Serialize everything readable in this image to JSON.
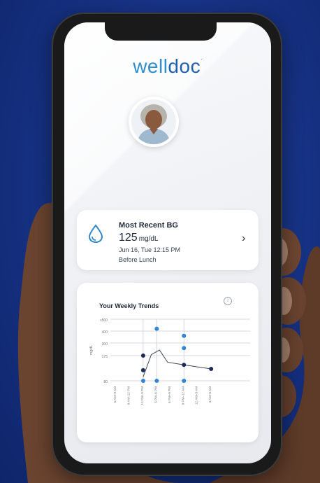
{
  "app": {
    "logo_light": "well",
    "logo_dark": "doc",
    "logo_mark": "."
  },
  "recent_bg": {
    "title": "Most Recent BG",
    "value": "125",
    "unit": "mg/dL",
    "date": "Jun 16, Tue 12:15 PM",
    "meal": "Before Lunch"
  },
  "trends": {
    "title": "Your Weekly Trends",
    "chart_data": {
      "type": "scatter",
      "title": "Your Weekly Trends",
      "ylabel": "mg/dL",
      "y_ticks": [
        ">500",
        "400",
        "300",
        "175",
        "80"
      ],
      "categories": [
        "6 AM–9 AM",
        "9 AM–12 PM",
        "12 PM–3 PM",
        "3 PM–6 PM",
        "6 PM–9 PM",
        "9 PM–12 AM",
        "12 AM–3 AM",
        "3 AM–6 AM"
      ],
      "points": [
        {
          "x": 2,
          "y": 175
        },
        {
          "x": 2,
          "y": 120
        },
        {
          "x": 2,
          "y": 80
        },
        {
          "x": 3,
          "y": 420
        },
        {
          "x": 3,
          "y": 80
        },
        {
          "x": 5,
          "y": 360
        },
        {
          "x": 5,
          "y": 250
        },
        {
          "x": 5,
          "y": 80
        },
        {
          "x": 5,
          "y": 140
        },
        {
          "x": 7,
          "y": 125
        }
      ],
      "trend_line": [
        {
          "x": 2,
          "y": 95
        },
        {
          "x": 2.6,
          "y": 185
        },
        {
          "x": 3.2,
          "y": 230
        },
        {
          "x": 3.8,
          "y": 150
        },
        {
          "x": 5,
          "y": 140
        },
        {
          "x": 7,
          "y": 125
        }
      ]
    }
  }
}
